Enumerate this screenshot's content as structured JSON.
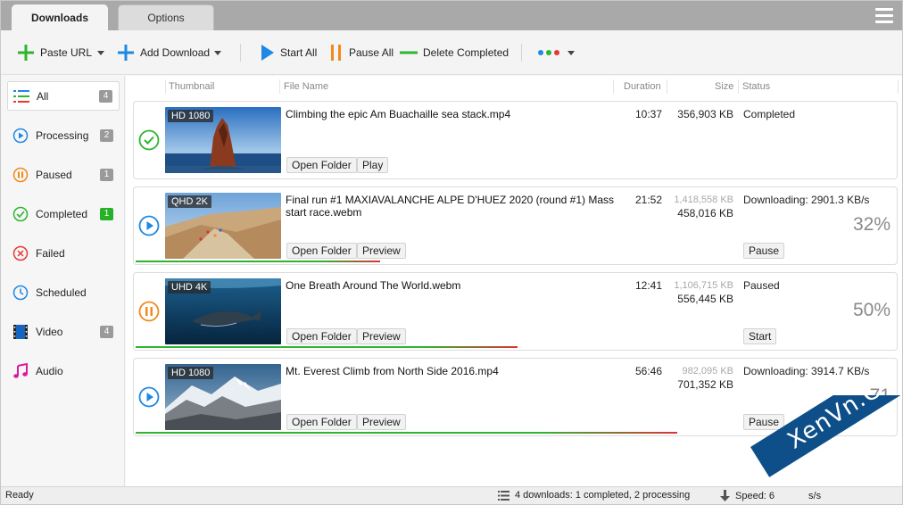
{
  "tabs": [
    {
      "label": "Downloads",
      "active": true
    },
    {
      "label": "Options",
      "active": false
    }
  ],
  "toolbar": {
    "paste_url": "Paste URL",
    "add_download": "Add Download",
    "start_all": "Start All",
    "pause_all": "Pause All",
    "delete_completed": "Delete Completed",
    "colors": {
      "accent_green": "#2db52d",
      "accent_blue": "#1e88e5",
      "accent_orange": "#f08a1c"
    }
  },
  "sidebar": {
    "items": [
      {
        "label": "All",
        "count": "4",
        "icon": "list-icon"
      },
      {
        "label": "Processing",
        "count": "2",
        "icon": "play-circle-icon"
      },
      {
        "label": "Paused",
        "count": "1",
        "icon": "pause-circle-icon"
      },
      {
        "label": "Completed",
        "count": "1",
        "icon": "check-circle-icon"
      },
      {
        "label": "Failed",
        "count": "",
        "icon": "x-circle-icon"
      },
      {
        "label": "Scheduled",
        "count": "",
        "icon": "clock-icon"
      },
      {
        "label": "Video",
        "count": "4",
        "icon": "film-icon"
      },
      {
        "label": "Audio",
        "count": "",
        "icon": "music-note-icon"
      }
    ]
  },
  "columns": {
    "thumbnail": "Thumbnail",
    "file_name": "File Name",
    "duration": "Duration",
    "size": "Size",
    "status": "Status"
  },
  "downloads": [
    {
      "quality": "HD 1080",
      "name": "Climbing the epic Am Buachaille sea stack.mp4",
      "duration": "10:37",
      "total_size": "",
      "size": "356,903 KB",
      "status": "Completed",
      "percent": "",
      "progress": 1.0,
      "button1": "Open Folder",
      "button2": "Play",
      "button3": "",
      "state": "completed"
    },
    {
      "quality": "QHD 2K",
      "name": "Final run #1  MAXIAVALANCHE ALPE D'HUEZ 2020 (round #1) Mass start race.webm",
      "duration": "21:52",
      "total_size": "1,418,558 KB",
      "size": "458,016 KB",
      "status": "Downloading: 2901.3 KB/s",
      "percent": "32%",
      "progress": 0.32,
      "button1": "Open Folder",
      "button2": "Preview",
      "button3": "Pause",
      "state": "processing"
    },
    {
      "quality": "UHD 4K",
      "name": "One Breath Around The World.webm",
      "duration": "12:41",
      "total_size": "1,106,715 KB",
      "size": "556,445 KB",
      "status": "Paused",
      "percent": "50%",
      "progress": 0.5,
      "button1": "Open Folder",
      "button2": "Preview",
      "button3": "Start",
      "state": "paused"
    },
    {
      "quality": "HD 1080",
      "name": "Mt. Everest Climb from North Side 2016.mp4",
      "duration": "56:46",
      "total_size": "982,095 KB",
      "size": "701,352 KB",
      "status": "Downloading: 3914.7 KB/s",
      "percent": "71",
      "progress": 0.71,
      "button1": "Open Folder",
      "button2": "Preview",
      "button3": "Pause",
      "state": "processing"
    }
  ],
  "statusbar": {
    "ready": "Ready",
    "summary": "4 downloads: 1 completed, 2 processing",
    "speed": "Speed: 6",
    "speed_suffix": "s/s"
  },
  "watermark": {
    "text": "XenVn.Com"
  }
}
